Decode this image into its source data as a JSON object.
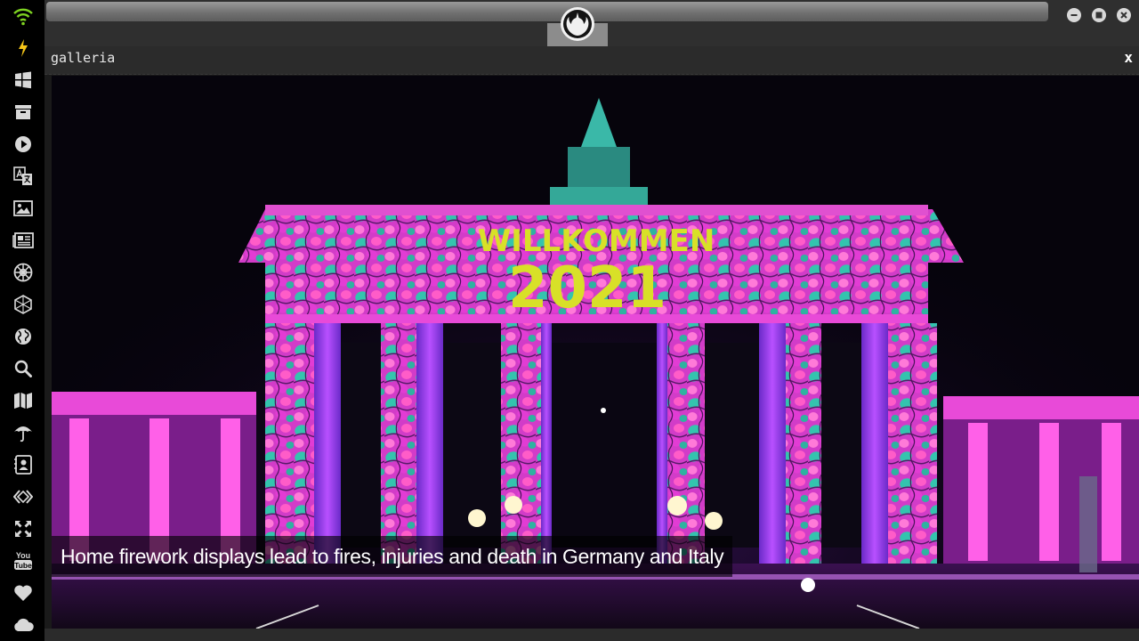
{
  "window": {
    "panel_title": "galleria",
    "panel_close_label": "x"
  },
  "sidebar": {
    "items": [
      {
        "icon": "wifi-icon"
      },
      {
        "icon": "lightning-icon"
      },
      {
        "icon": "windows-icon"
      },
      {
        "icon": "archive-box-icon"
      },
      {
        "icon": "play-circle-icon"
      },
      {
        "icon": "translate-icon"
      },
      {
        "icon": "image-icon"
      },
      {
        "icon": "newspaper-icon"
      },
      {
        "icon": "galactic-empire-icon"
      },
      {
        "icon": "hexagon-sphere-icon"
      },
      {
        "icon": "globe-icon"
      },
      {
        "icon": "search-icon"
      },
      {
        "icon": "map-icon"
      },
      {
        "icon": "umbrella-icon"
      },
      {
        "icon": "contacts-icon"
      },
      {
        "icon": "code-diamond-icon"
      },
      {
        "icon": "expand-arrows-icon"
      },
      {
        "icon": "youtube-icon"
      },
      {
        "icon": "heart-icon"
      },
      {
        "icon": "cloud-icon"
      }
    ],
    "youtube_text_1": "You",
    "youtube_text_2": "Tube"
  },
  "topbar": {
    "logo_icon": "rebel-alliance-icon",
    "buttons": [
      {
        "icon": "minimize-icon"
      },
      {
        "icon": "maximize-icon"
      },
      {
        "icon": "close-icon"
      }
    ]
  },
  "gallery": {
    "caption": "Home firework displays lead to fires, injuries and death in Germany and Italy",
    "image_text_1": "WILLKOMMEN",
    "image_text_2": "2021"
  },
  "colors": {
    "sidebar_bg": "#000000",
    "icon_color": "#d8d8d8",
    "wifi_color": "#7ed321",
    "lightning_color": "#f5c518",
    "panel_bg": "#2b2b2b",
    "gate_pink": "#e040d0",
    "gate_teal": "#33c8b0",
    "text_yellow": "#d8e028"
  }
}
